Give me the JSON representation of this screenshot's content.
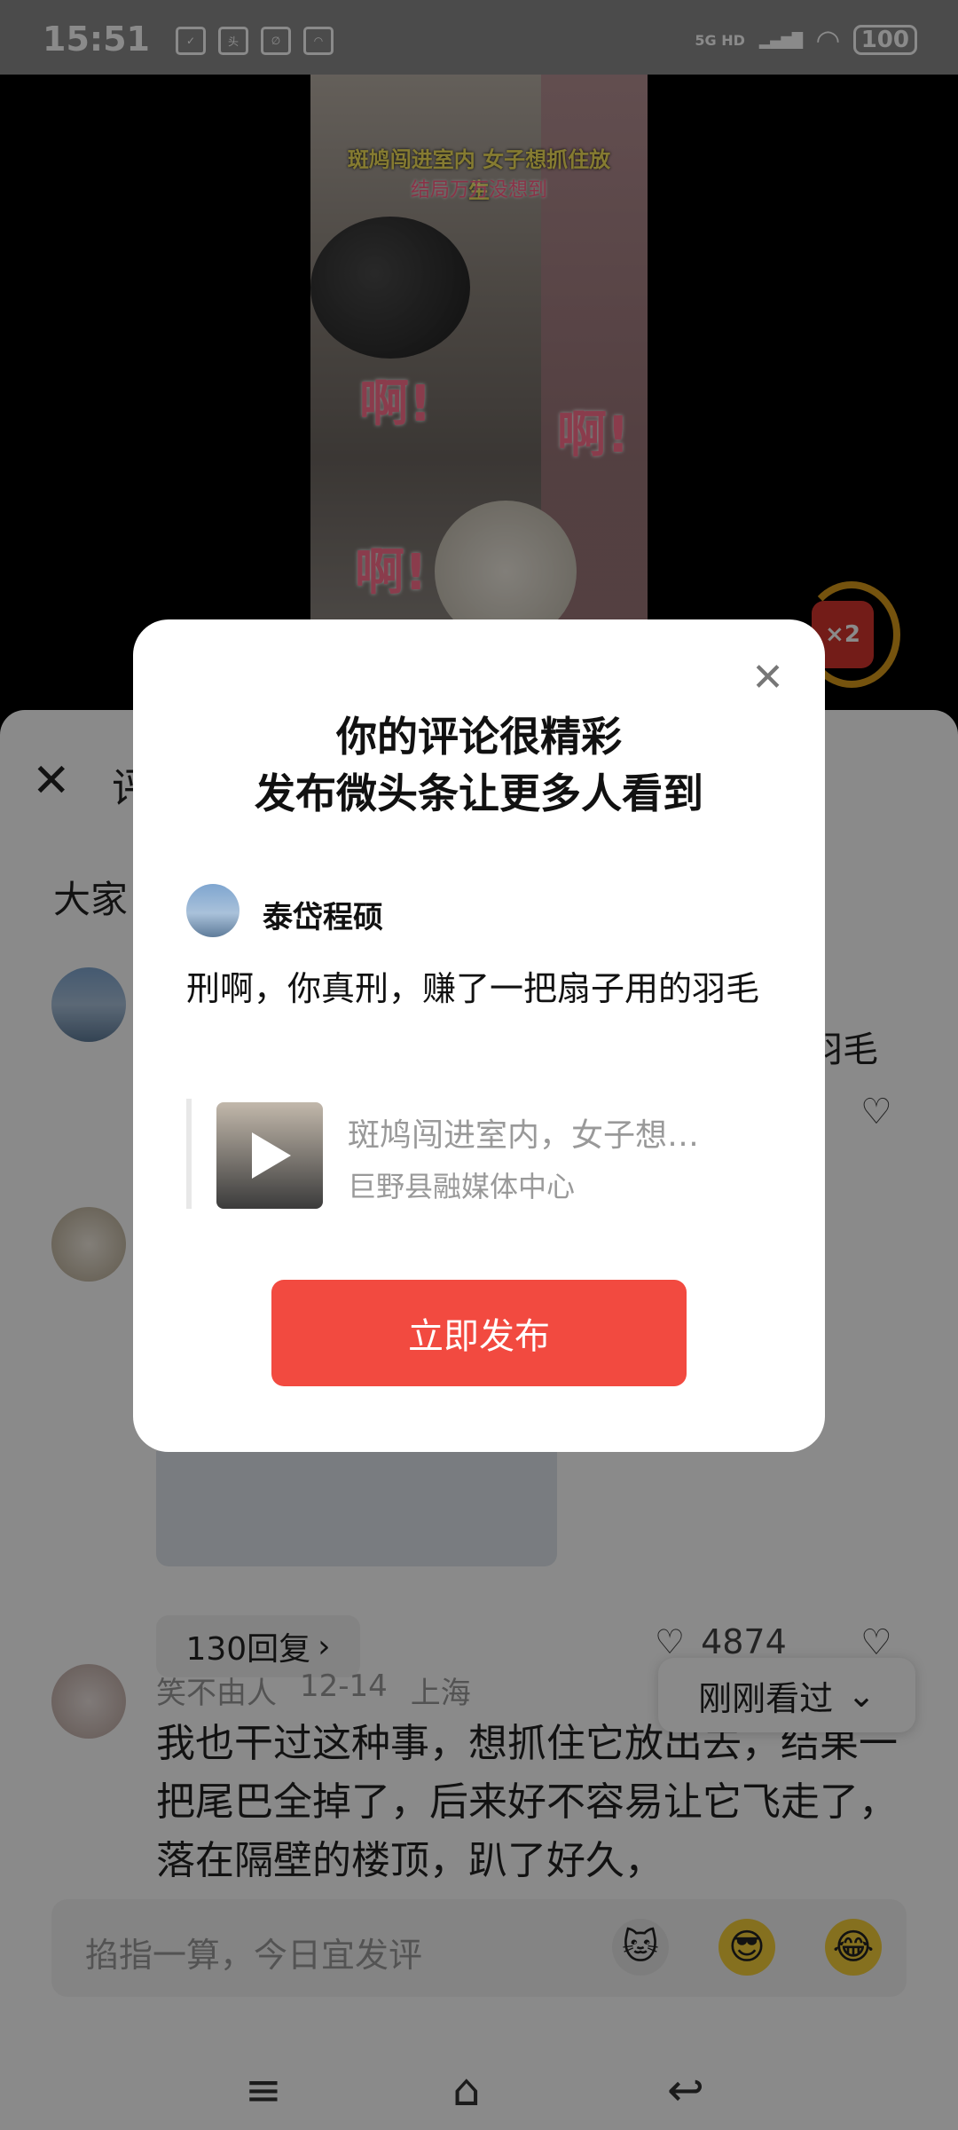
{
  "status_bar": {
    "time": "15:51",
    "network": "5G HD",
    "battery": "100"
  },
  "video": {
    "title_line1": "斑鸠闯进室内 女子想抓住放生",
    "title_line2": "结局万万没想到",
    "exclaim": "啊!",
    "reward_label": "×2"
  },
  "sheet": {
    "title": "评",
    "filter_label": "大家",
    "comment1_tail": "羽毛",
    "reply_count_label": "130回复",
    "like_count": "4874",
    "comment3": {
      "user": "笑不由人",
      "date": "12-14",
      "location": "上海",
      "text": "我也干过这种事，想抓住它放出去，结果一把尾巴全掉了，后来好不容易让它飞走了，落在隔壁的楼顶，趴了好久，"
    },
    "recent_chip": "刚刚看过",
    "input_placeholder": "掐指一算，今日宜发评"
  },
  "modal": {
    "title_line1": "你的评论很精彩",
    "title_line2": "发布微头条让更多人看到",
    "username": "泰岱程硕",
    "comment_text": "刑啊，你真刑，赚了一把扇子用的羽毛",
    "quote_title": "斑鸠闯进室内，女子想…",
    "quote_source": "巨野县融媒体中心",
    "publish_label": "立即发布"
  }
}
